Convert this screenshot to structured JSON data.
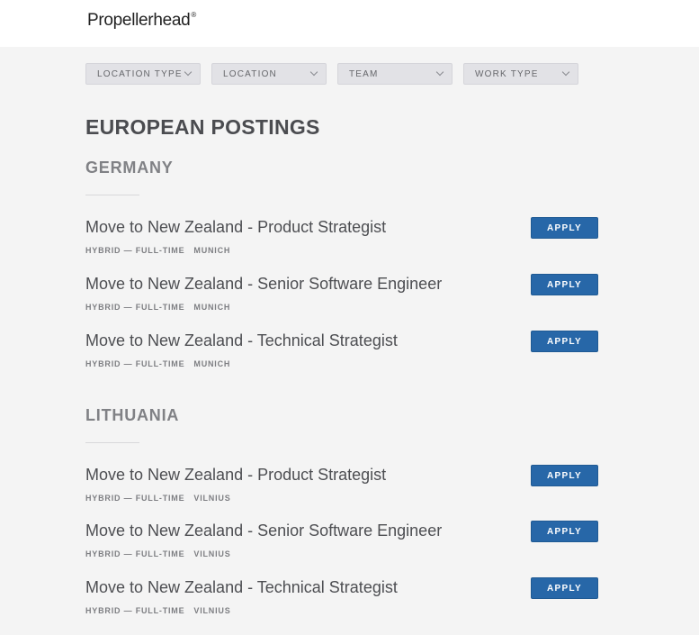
{
  "brand": {
    "name": "Propellerhead",
    "mark": "®"
  },
  "filters": [
    {
      "label": "LOCATION TYPE"
    },
    {
      "label": "LOCATION"
    },
    {
      "label": "TEAM"
    },
    {
      "label": "WORK TYPE"
    }
  ],
  "page": {
    "title": "EUROPEAN POSTINGS"
  },
  "apply_label": "APPLY",
  "groups": [
    {
      "title": "GERMANY",
      "postings": [
        {
          "title": "Move to New Zealand - Product Strategist",
          "commitment": "HYBRID — FULL-TIME",
          "location": "MUNICH"
        },
        {
          "title": "Move to New Zealand - Senior Software Engineer",
          "commitment": "HYBRID — FULL-TIME",
          "location": "MUNICH"
        },
        {
          "title": "Move to New Zealand - Technical Strategist",
          "commitment": "HYBRID — FULL-TIME",
          "location": "MUNICH"
        }
      ]
    },
    {
      "title": "LITHUANIA",
      "postings": [
        {
          "title": "Move to New Zealand - Product Strategist",
          "commitment": "HYBRID — FULL-TIME",
          "location": "VILNIUS"
        },
        {
          "title": "Move to New Zealand - Senior Software Engineer",
          "commitment": "HYBRID — FULL-TIME",
          "location": "VILNIUS"
        },
        {
          "title": "Move to New Zealand - Technical Strategist",
          "commitment": "HYBRID — FULL-TIME",
          "location": "VILNIUS"
        }
      ]
    }
  ],
  "colors": {
    "background": "#f4f4f4",
    "header": "#ffffff",
    "accent": "#2767a8"
  }
}
